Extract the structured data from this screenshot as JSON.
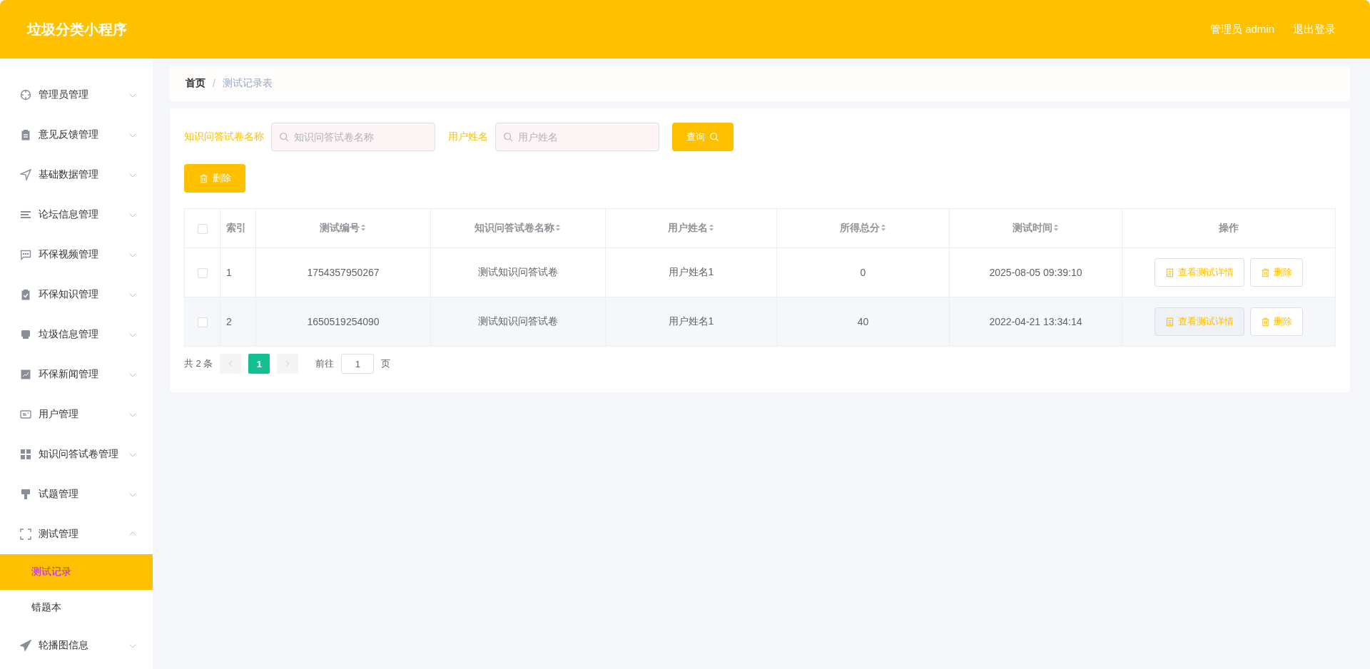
{
  "header": {
    "title": "垃圾分类小程序",
    "user": "管理员 admin",
    "logout": "退出登录"
  },
  "sidebar": {
    "items": [
      {
        "label": "管理员管理",
        "expanded": false
      },
      {
        "label": "意见反馈管理",
        "expanded": false
      },
      {
        "label": "基础数据管理",
        "expanded": false
      },
      {
        "label": "论坛信息管理",
        "expanded": false
      },
      {
        "label": "环保视频管理",
        "expanded": false
      },
      {
        "label": "环保知识管理",
        "expanded": false
      },
      {
        "label": "垃圾信息管理",
        "expanded": false
      },
      {
        "label": "环保新闻管理",
        "expanded": false
      },
      {
        "label": "用户管理",
        "expanded": false
      },
      {
        "label": "知识问答试卷管理",
        "expanded": false
      },
      {
        "label": "试题管理",
        "expanded": false
      },
      {
        "label": "测试管理",
        "expanded": true,
        "children": [
          {
            "label": "测试记录",
            "selected": true
          },
          {
            "label": "错题本",
            "selected": false
          }
        ]
      },
      {
        "label": "轮播图信息",
        "expanded": false
      }
    ]
  },
  "breadcrumb": {
    "items": [
      "首页",
      "测试记录表"
    ],
    "separator": "/"
  },
  "search": {
    "fields": [
      {
        "label": "知识问答试卷名称",
        "placeholder": "知识问答试卷名称"
      },
      {
        "label": "用户姓名",
        "placeholder": "用户姓名"
      }
    ],
    "button": "查询"
  },
  "delete_button": "删除",
  "table": {
    "select_all": false,
    "columns": [
      {
        "label": "索引",
        "kind": "plain"
      },
      {
        "label": "测试编号",
        "kind": "sortable"
      },
      {
        "label": "知识问答试卷名称",
        "kind": "sortable"
      },
      {
        "label": "用户姓名",
        "kind": "sortable"
      },
      {
        "label": "所得总分",
        "kind": "sortable"
      },
      {
        "label": "测试时间",
        "kind": "sortable"
      },
      {
        "label": "操作",
        "kind": "plain"
      }
    ],
    "rows": [
      {
        "checked": false,
        "highlighted": false,
        "cells": [
          "1",
          "1754357950267",
          "测试知识问答试卷",
          "用户姓名1",
          "0",
          "2025-08-05 09:39:10"
        ],
        "actions": [
          "查看测试详情",
          "删除"
        ]
      },
      {
        "checked": false,
        "highlighted": true,
        "cells": [
          "2",
          "1650519254090",
          "测试知识问答试卷",
          "用户姓名1",
          "40",
          "2022-04-21 13:34:14"
        ],
        "actions": [
          "查看测试详情",
          "删除"
        ]
      }
    ]
  },
  "pagination": {
    "total": "共 2 条",
    "pages": [
      {
        "label": "1",
        "selected": true
      }
    ],
    "goto_label": "前往",
    "goto_value": "1",
    "page_suffix": "页"
  }
}
